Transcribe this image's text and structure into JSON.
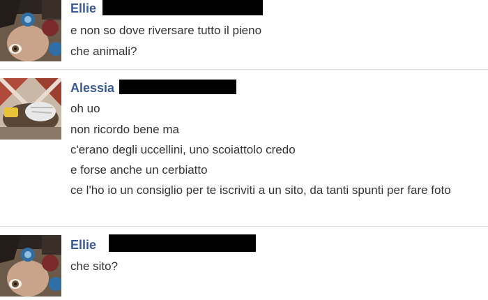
{
  "messages": [
    {
      "sender_visible": "Ellie",
      "lines": [
        "e non so dove riversare tutto il pieno",
        "che animali?"
      ]
    },
    {
      "sender_visible": "Alessia",
      "lines": [
        "oh uo",
        "non ricordo bene ma",
        "c'erano degli uccellini, uno scoiattolo credo",
        "e forse anche un cerbiatto",
        "ce l'ho io un consiglio per te iscriviti a un sito, da tanti spunti per fare foto"
      ]
    },
    {
      "sender_visible": "Ellie",
      "lines": [
        "che sito?"
      ]
    }
  ],
  "colors": {
    "sender_name": "#3b5998",
    "message_text": "#333333",
    "divider": "#e1e4ea",
    "redaction": "#000000"
  }
}
